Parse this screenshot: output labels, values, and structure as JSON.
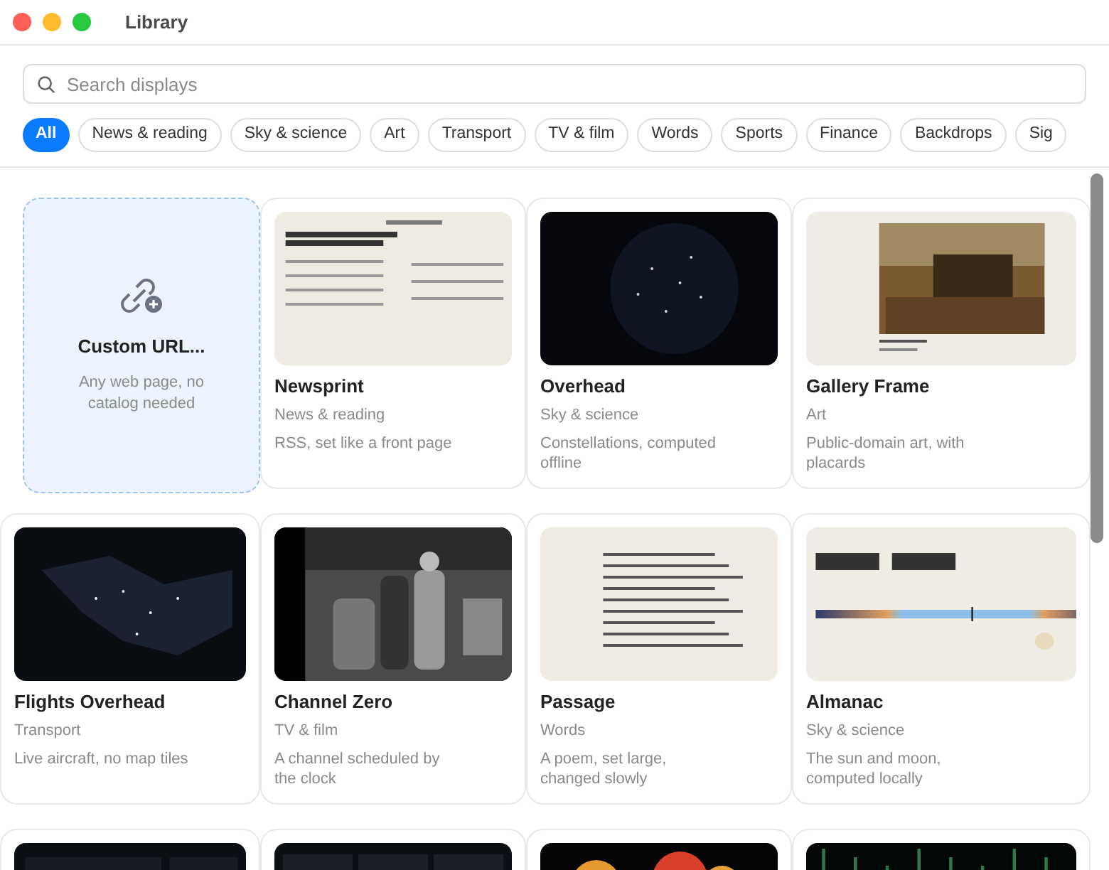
{
  "window": {
    "title": "Library"
  },
  "search": {
    "placeholder": "Search displays"
  },
  "filters": [
    {
      "label": "All",
      "selected": true
    },
    {
      "label": "News & reading",
      "selected": false
    },
    {
      "label": "Sky & science",
      "selected": false
    },
    {
      "label": "Art",
      "selected": false
    },
    {
      "label": "Transport",
      "selected": false
    },
    {
      "label": "TV & film",
      "selected": false
    },
    {
      "label": "Words",
      "selected": false
    },
    {
      "label": "Sports",
      "selected": false
    },
    {
      "label": "Finance",
      "selected": false
    },
    {
      "label": "Backdrops",
      "selected": false
    },
    {
      "label": "Sig",
      "selected": false
    }
  ],
  "cards": [
    {
      "kind": "custom",
      "title": "Custom URL...",
      "description": "Any web page, no catalog needed"
    },
    {
      "kind": "paper",
      "title": "Newsprint",
      "category": "News & reading",
      "description": "RSS, set like a front page"
    },
    {
      "kind": "stars",
      "title": "Overhead",
      "category": "Sky & science",
      "description": "Constellations, computed offline"
    },
    {
      "kind": "painting",
      "title": "Gallery Frame",
      "category": "Art",
      "description": "Public-domain art, with placards"
    },
    {
      "kind": "map",
      "title": "Flights Overhead",
      "category": "Transport",
      "description": "Live aircraft, no map tiles"
    },
    {
      "kind": "film",
      "title": "Channel Zero",
      "category": "TV & film",
      "description": "A channel scheduled by the clock"
    },
    {
      "kind": "poem",
      "title": "Passage",
      "category": "Words",
      "description": "A poem, set large, changed slowly"
    },
    {
      "kind": "sun",
      "title": "Almanac",
      "category": "Sky & science",
      "description": "The sun and moon, computed locally"
    },
    {
      "kind": "panels"
    },
    {
      "kind": "board"
    },
    {
      "kind": "blobs"
    },
    {
      "kind": "rain"
    }
  ]
}
